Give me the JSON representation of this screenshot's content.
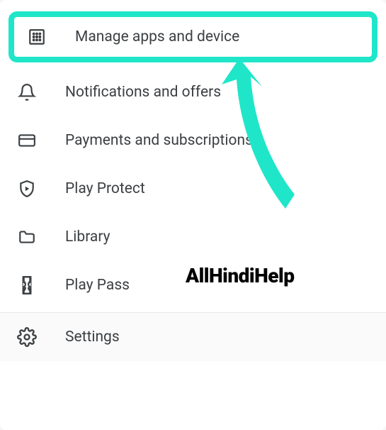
{
  "menu": {
    "manage": "Manage apps and device",
    "notifications": "Notifications and offers",
    "payments": "Payments and subscriptions",
    "playprotect": "Play Protect",
    "library": "Library",
    "playpass": "Play Pass",
    "settings": "Settings"
  },
  "watermark": "AllHindiHelp"
}
